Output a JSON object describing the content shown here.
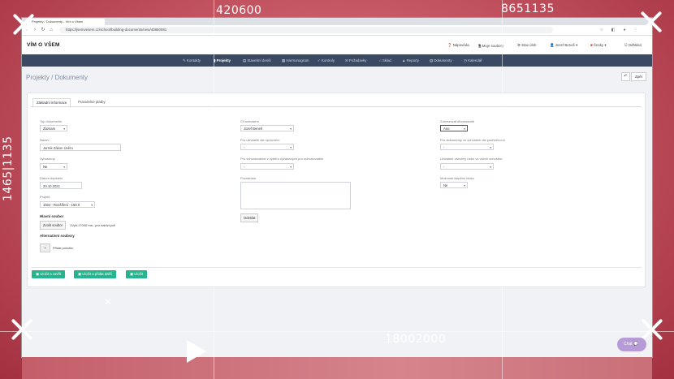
{
  "overlay": {
    "ruler_top_left": "420600",
    "ruler_top_right": "8651135",
    "ruler_left": "1465|1135",
    "ruler_bottom": "18002000",
    "chat_label": "Chat"
  },
  "browser": {
    "tab_title": "Projekty / Dokumenty - Vím o Všem",
    "url": "https://jsemvesem.cz/school/building-documents/new/40850081"
  },
  "app": {
    "logo": "VÍM O VŠEM",
    "header_links": [
      "Nápověda",
      "Moje soubory",
      "Stav úloh",
      "Jozef Beneš",
      "Česky",
      "Odhlásit"
    ],
    "nav": [
      "Kontakty",
      "Projekty",
      "Stavební deník",
      "Harmonogram",
      "Kontroly",
      "Požadavky",
      "Sklad",
      "Reporty",
      "Dokumenty",
      "Kalendář"
    ],
    "nav_active_index": 1,
    "page_title": "Projekty / Dokumenty",
    "back_label": "Zpět"
  },
  "form": {
    "tabs": [
      "Základní informace",
      "Pravidelné platby"
    ],
    "typ_label": "Typ dokumentu",
    "typ_value": "Záznam",
    "nazev_label": "Název",
    "nazev_value": "Jarrek Zákon Úvěru",
    "vyhrazeny_label": "Vyhrazený",
    "vyhrazeny_value": "Ne",
    "datum_label": "Datum doplnění",
    "datum_value": "20.10.2021",
    "projekt_label": "Projekt",
    "projekt_value": "1924 - Rozšíření - 150.0",
    "hlavni_label": "Hlavní soubor",
    "choose_label": "Zvolit soubor",
    "file_name": "1Vyh.17000 ma...pro nabízí.pdf",
    "alt_label": "Alternativní soubory",
    "add_label": "Přidat položku",
    "cil_label": "Cíl schválení",
    "cil_value": "Jozef Beneš",
    "pro_label": "Pro uživatele dle oprávnění",
    "pro_value": "-",
    "pro2_label": "Pro schvalovatele z výběru vyžádaných pro schvalovatele",
    "pro2_value": "-",
    "poznamka_label": "Poznámka",
    "odeslat_label": "Odeslat",
    "zobrazit_label": "Zobrazovat dlouhodobě",
    "zobrazit_value": "Ano",
    "pro3_label": "Pro dokumenty ve schválení dle podřízenosti",
    "pro3_value": "-",
    "pro4_label": "Uživatelé všechny nebo ve všech schválení",
    "pro4_value": "-",
    "poslat_label": "Možnosti slepého bloku",
    "poslat_value": "Ne",
    "buttons": [
      "Uložit a zavřít",
      "Uložit a přidat další",
      "Uložit"
    ]
  }
}
